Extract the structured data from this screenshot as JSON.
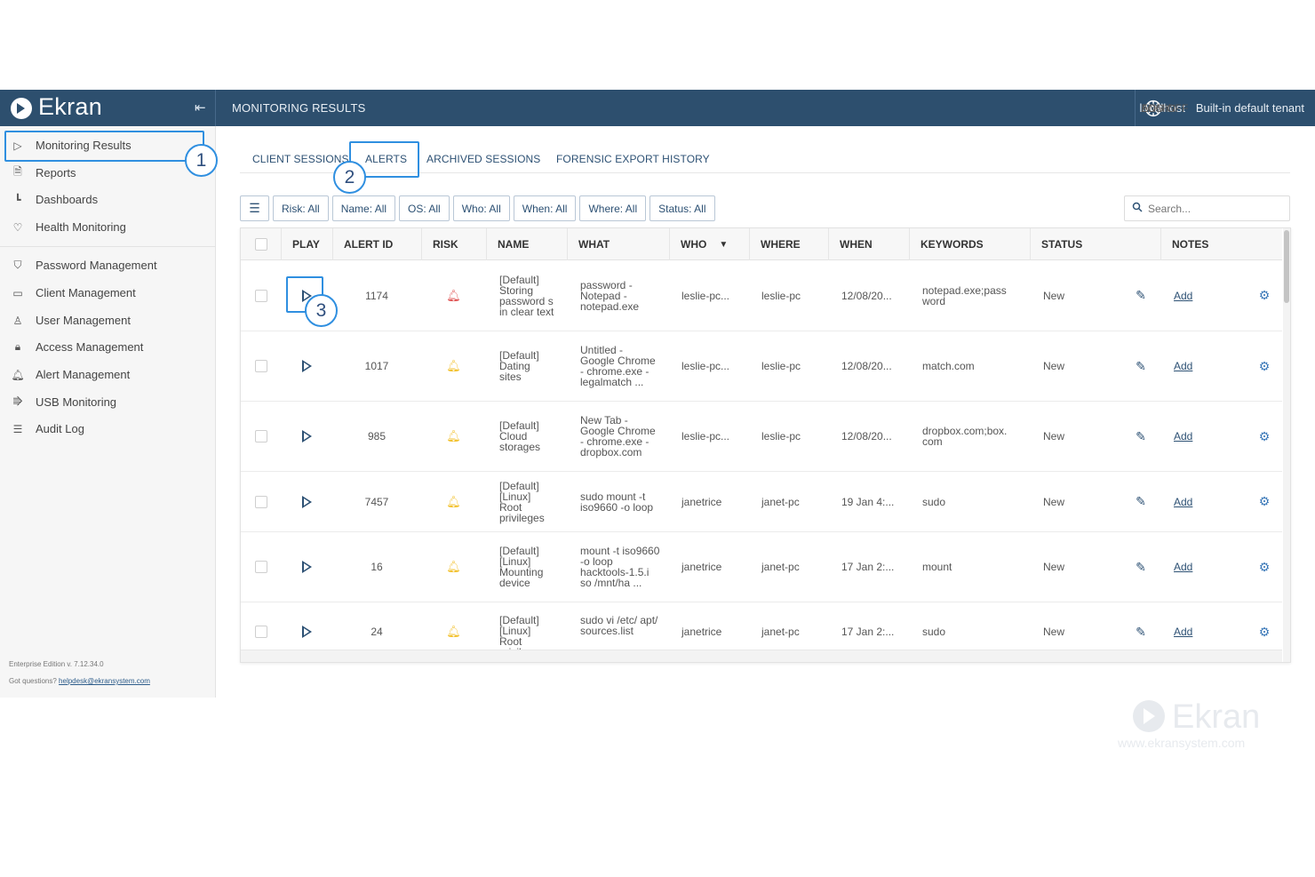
{
  "app": {
    "name": "Ekran"
  },
  "topbar": {
    "page_title": "MONITORING RESULTS",
    "host": "localhost",
    "tenant": "Built-in default tenant",
    "user": "ADMIN",
    "logoff": "LOG OFF",
    "language": "EN"
  },
  "sidebar": {
    "items": [
      {
        "label": "Monitoring Results",
        "icon": "play-icon"
      },
      {
        "label": "Reports",
        "icon": "report-icon"
      },
      {
        "label": "Dashboards",
        "icon": "dashboard-icon"
      },
      {
        "label": "Health Monitoring",
        "icon": "heart-icon"
      },
      {
        "label": "Password Management",
        "icon": "shield-icon"
      },
      {
        "label": "Client Management",
        "icon": "monitor-icon"
      },
      {
        "label": "User Management",
        "icon": "user-icon"
      },
      {
        "label": "Access Management",
        "icon": "lock-icon"
      },
      {
        "label": "Alert Management",
        "icon": "bell-icon"
      },
      {
        "label": "USB Monitoring",
        "icon": "usb-icon"
      },
      {
        "label": "Audit Log",
        "icon": "list-icon"
      }
    ],
    "footer_version": "Enterprise Edition v. 7.12.34.0",
    "footer_questions": "Got questions?",
    "footer_email": "helpdesk@ekransystem.com"
  },
  "annotations": [
    "1",
    "2",
    "3"
  ],
  "tabs": [
    {
      "label": "CLIENT SESSIONS"
    },
    {
      "label": "ALERTS"
    },
    {
      "label": "ARCHIVED SESSIONS"
    },
    {
      "label": "FORENSIC EXPORT HISTORY"
    }
  ],
  "filters": [
    "Risk: All",
    "Name: All",
    "OS: All",
    "Who: All",
    "When: All",
    "Where: All",
    "Status: All"
  ],
  "search": {
    "placeholder": "Search..."
  },
  "table": {
    "headers": [
      "PLAY",
      "ALERT ID",
      "RISK",
      "NAME",
      "WHAT",
      "WHO",
      "WHERE",
      "WHEN",
      "KEYWORDS",
      "STATUS",
      "NOTES"
    ],
    "rows": [
      {
        "alert_id": "1174",
        "risk": "high",
        "name": "[Default] Storing password s in clear text",
        "what": "password - Notepad - notepad.exe",
        "who": "leslie-pc...",
        "where": "leslie-pc",
        "when": "12/08/20...",
        "keywords": "notepad.exe;pass word",
        "status": "New",
        "notes": "Add"
      },
      {
        "alert_id": "1017",
        "risk": "medium",
        "name": "[Default] Dating sites",
        "what": "Untitled - Google Chrome - chrome.exe - legalmatch ...",
        "who": "leslie-pc...",
        "where": "leslie-pc",
        "when": "12/08/20...",
        "keywords": "match.com",
        "status": "New",
        "notes": "Add"
      },
      {
        "alert_id": "985",
        "risk": "medium",
        "name": "[Default] Cloud storages",
        "what": "New Tab - Google Chrome - chrome.exe - dropbox.com",
        "who": "leslie-pc...",
        "where": "leslie-pc",
        "when": "12/08/20...",
        "keywords": "dropbox.com;box. com",
        "status": "New",
        "notes": "Add"
      },
      {
        "alert_id": "7457",
        "risk": "medium",
        "name": "[Default] [Linux] Root privileges",
        "what": "sudo mount -t iso9660 -o loop",
        "who": "janetrice",
        "where": "janet-pc",
        "when": "19 Jan 4:...",
        "keywords": "sudo",
        "status": "New",
        "notes": "Add"
      },
      {
        "alert_id": "16",
        "risk": "medium",
        "name": "[Default] [Linux] Mounting device",
        "what": "mount -t iso9660 -o loop hacktools-1.5.i so /mnt/ha ...",
        "who": "janetrice",
        "where": "janet-pc",
        "when": "17 Jan 2:...",
        "keywords": "mount",
        "status": "New",
        "notes": "Add"
      },
      {
        "alert_id": "24",
        "risk": "medium",
        "name": "[Default] [Linux] Root privileges",
        "what": "sudo vi /etc/ apt/ sources.list",
        "who": "janetrice",
        "where": "janet-pc",
        "when": "17 Jan 2:...",
        "keywords": "sudo",
        "status": "New",
        "notes": "Add"
      }
    ]
  },
  "watermark": {
    "brand": "Ekran",
    "url": "www.ekransystem.com"
  },
  "colors": {
    "topbar": "#2d4f6e",
    "accent": "#2f8fe0",
    "risk_high": "#e05555",
    "risk_medium": "#f2c12e"
  }
}
